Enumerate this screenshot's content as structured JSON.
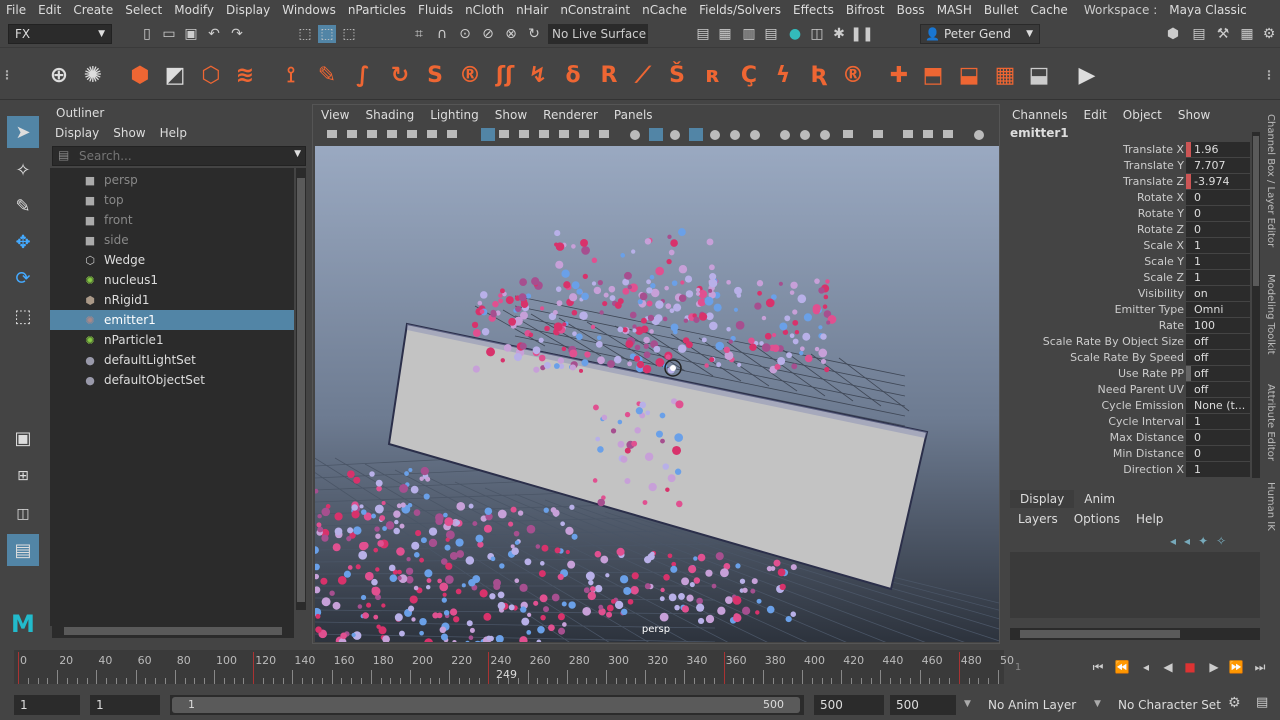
{
  "menubar": {
    "items": [
      "File",
      "Edit",
      "Create",
      "Select",
      "Modify",
      "Display",
      "Windows",
      "nParticles",
      "Fluids",
      "nCloth",
      "nHair",
      "nConstraint",
      "nCache",
      "Fields/Solvers",
      "Effects",
      "Bifrost",
      "Boss",
      "MASH",
      "Bullet",
      "Cache"
    ],
    "workspace_label": "Workspace :",
    "workspace_value": "Maya Classic"
  },
  "statusline": {
    "menuset": "FX",
    "live_surface": "No Live Surface",
    "user": "Peter Gend"
  },
  "outliner": {
    "title": "Outliner",
    "menu": [
      "Display",
      "Show",
      "Help"
    ],
    "search_placeholder": "Search...",
    "items": [
      {
        "label": "persp",
        "icon": "camera-icon",
        "dim": true,
        "selected": false
      },
      {
        "label": "top",
        "icon": "camera-icon",
        "dim": true,
        "selected": false
      },
      {
        "label": "front",
        "icon": "camera-icon",
        "dim": true,
        "selected": false
      },
      {
        "label": "side",
        "icon": "camera-icon",
        "dim": true,
        "selected": false
      },
      {
        "label": "Wedge",
        "icon": "wedge-icon",
        "dim": false,
        "selected": false
      },
      {
        "label": "nucleus1",
        "icon": "nucleus-icon",
        "dim": false,
        "selected": false
      },
      {
        "label": "nRigid1",
        "icon": "nrigid-icon",
        "dim": false,
        "selected": false
      },
      {
        "label": "emitter1",
        "icon": "emitter-icon",
        "dim": false,
        "selected": true
      },
      {
        "label": "nParticle1",
        "icon": "nparticle-icon",
        "dim": false,
        "selected": false
      },
      {
        "label": "defaultLightSet",
        "icon": "set-icon",
        "dim": false,
        "selected": false
      },
      {
        "label": "defaultObjectSet",
        "icon": "set-icon",
        "dim": false,
        "selected": false
      }
    ]
  },
  "viewport": {
    "menu": [
      "View",
      "Shading",
      "Lighting",
      "Show",
      "Renderer",
      "Panels"
    ],
    "camera": "persp"
  },
  "channelbox": {
    "menu": [
      "Channels",
      "Edit",
      "Object",
      "Show"
    ],
    "object": "emitter1",
    "rows": [
      {
        "label": "Translate X",
        "value": "1.96",
        "mark": "key"
      },
      {
        "label": "Translate Y",
        "value": "7.707",
        "mark": ""
      },
      {
        "label": "Translate Z",
        "value": "-3.974",
        "mark": "key"
      },
      {
        "label": "Rotate X",
        "value": "0",
        "mark": ""
      },
      {
        "label": "Rotate Y",
        "value": "0",
        "mark": ""
      },
      {
        "label": "Rotate Z",
        "value": "0",
        "mark": ""
      },
      {
        "label": "Scale X",
        "value": "1",
        "mark": ""
      },
      {
        "label": "Scale Y",
        "value": "1",
        "mark": ""
      },
      {
        "label": "Scale Z",
        "value": "1",
        "mark": ""
      },
      {
        "label": "Visibility",
        "value": "on",
        "mark": ""
      },
      {
        "label": "Emitter Type",
        "value": "Omni",
        "mark": ""
      },
      {
        "label": "Rate",
        "value": "100",
        "mark": ""
      },
      {
        "label": "Scale Rate By Object Size",
        "value": "off",
        "mark": ""
      },
      {
        "label": "Scale Rate By Speed",
        "value": "off",
        "mark": ""
      },
      {
        "label": "Use Rate PP",
        "value": "off",
        "mark": "grey"
      },
      {
        "label": "Need Parent UV",
        "value": "off",
        "mark": ""
      },
      {
        "label": "Cycle Emission",
        "value": "None (t...",
        "mark": ""
      },
      {
        "label": "Cycle Interval",
        "value": "1",
        "mark": ""
      },
      {
        "label": "Max Distance",
        "value": "0",
        "mark": ""
      },
      {
        "label": "Min Distance",
        "value": "0",
        "mark": ""
      },
      {
        "label": "Direction X",
        "value": "1",
        "mark": ""
      }
    ],
    "side_tabs": [
      "Channel Box / Layer Editor",
      "Modeling Toolkit",
      "Attribute Editor",
      "Human IK"
    ]
  },
  "layer_editor": {
    "tabs": [
      "Display",
      "Anim"
    ],
    "menu": [
      "Layers",
      "Options",
      "Help"
    ]
  },
  "timeline": {
    "ticks": [
      "0",
      "20",
      "40",
      "60",
      "80",
      "100",
      "120",
      "140",
      "160",
      "180",
      "200",
      "220",
      "240",
      "260",
      "280",
      "300",
      "320",
      "340",
      "360",
      "380",
      "400",
      "420",
      "440",
      "460",
      "480",
      "50"
    ],
    "current_frame": "249",
    "frame_field": "1"
  },
  "range": {
    "start": "1",
    "anim_start": "1",
    "slider_start": "1",
    "slider_end": "500",
    "anim_end": "500",
    "end": "500",
    "anim_layer": "No Anim Layer",
    "character_set": "No Character Set"
  }
}
